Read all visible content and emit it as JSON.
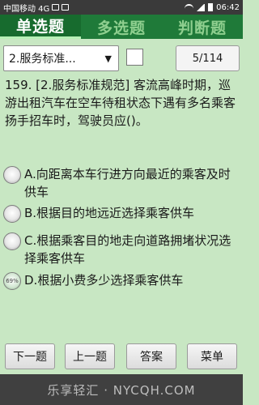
{
  "status_bar": {
    "carrier": "中国移动 4G",
    "time": "06:42"
  },
  "tabs": [
    {
      "label": "单选题",
      "active": true
    },
    {
      "label": "多选题",
      "active": false
    },
    {
      "label": "判断题",
      "active": false
    }
  ],
  "toolbar": {
    "category_selected": "2.服务标准...",
    "counter": "5/114"
  },
  "question": {
    "text": "159. [2.服务标准规范] 客流高峰时期，巡游出租汽车在空车待租状态下遇有多名乘客扬手招车时，驾驶员应()。"
  },
  "options": [
    {
      "label": "A.向距离本车行进方向最近的乘客及时供车"
    },
    {
      "label": "B.根据目的地远近选择乘客供车"
    },
    {
      "label": "C.根据乘客目的地走向道路拥堵状况选择乘客供车"
    },
    {
      "label": "D.根据小费多少选择乘客供车",
      "badge": "69%"
    }
  ],
  "buttons": {
    "next": "下一题",
    "prev": "上一题",
    "answer": "答案",
    "menu": "菜单"
  },
  "watermark": "乐享轻汇 · NYCQH.COM",
  "colors": {
    "background": "#c8e7c3",
    "tab_active": "#176b2e",
    "tab_inactive": "#1f7a39"
  },
  "icons": [
    "sim-icon",
    "wifi-icon",
    "signal-icon",
    "battery-icon",
    "caret-down-icon",
    "radio-icon"
  ]
}
